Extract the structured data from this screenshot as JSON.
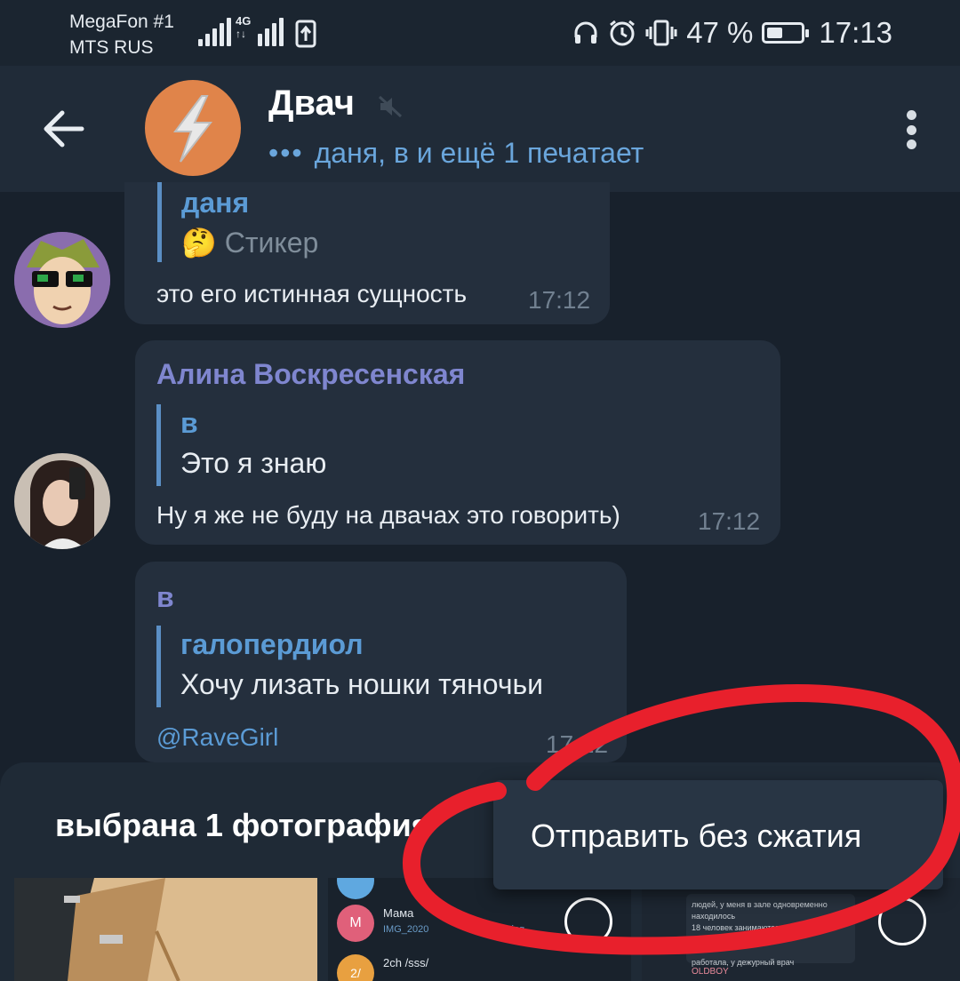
{
  "status_bar": {
    "carrier1": "MegaFon #1",
    "carrier2": "MTS RUS",
    "net": "4G",
    "battery": "47 %",
    "battery_level": 0.47,
    "clock": "17:13"
  },
  "header": {
    "title": "Двач",
    "typing": "даня, в и ещё 1 печатает",
    "typing_dots": "•••"
  },
  "messages": [
    {
      "reply_name": "даня",
      "reply_emoji": "🤔",
      "reply_text": "Стикер",
      "text": "это его истинная сущность",
      "time": "17:12"
    },
    {
      "sender": "Алина Воскресенская",
      "reply_name": "в",
      "reply_text": "Это я знаю",
      "text": "Ну я же не буду на двачах это говорить)",
      "time": "17:12"
    },
    {
      "sender": "в",
      "reply_name": "галопердиол",
      "reply_text": "Хочу лизать ношки тяночьи",
      "text": "@RaveGirl",
      "time": "17:12"
    }
  ],
  "sheet": {
    "title": "выбрана 1 фотография",
    "popup_label": "Отправить без сжатия",
    "thumb2": {
      "item1_name": "Мама",
      "item1_sub": "IMG_2020",
      "item1_ext": "jpg",
      "item1_letter": "M",
      "item2_name": "2ch /sss/",
      "item2_letter": "2/"
    },
    "thumb3": {
      "text_line1": "людей, у меня в зале одновременно находилось",
      "text_line2": "18 человек занимаются и образовательное лицо",
      "text_line3": "работала, у дежурный врач",
      "tag": "OLDBOY"
    }
  },
  "colors": {
    "bg": "#18212c",
    "bubble": "#242f3d",
    "accent_blue": "#5b9bd5",
    "sender_purple": "#7f86cf",
    "annotation_red": "#e8202c"
  }
}
